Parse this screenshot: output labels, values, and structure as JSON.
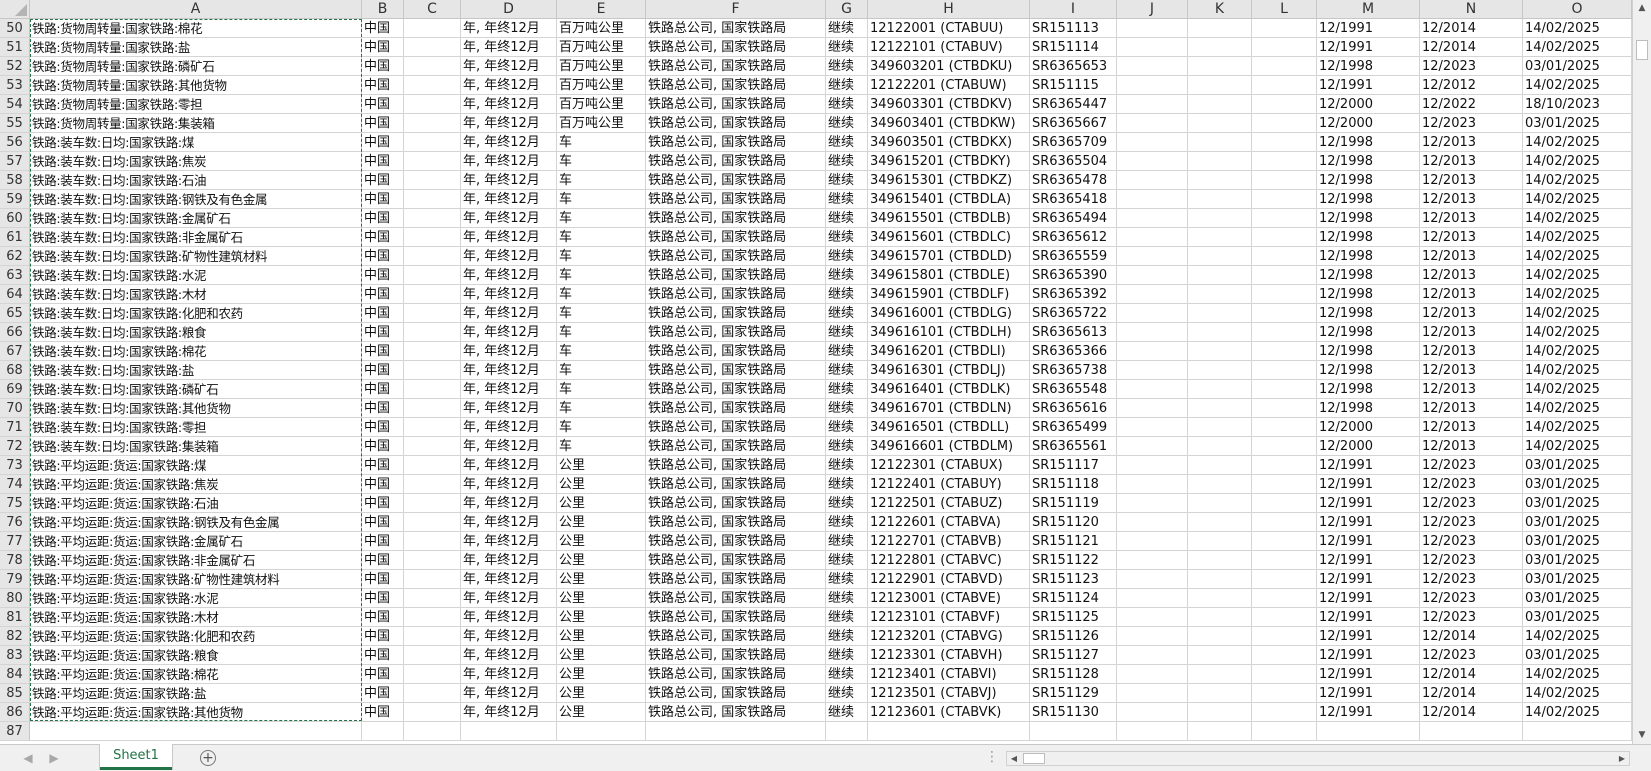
{
  "columns": [
    "A",
    "B",
    "C",
    "D",
    "E",
    "F",
    "G",
    "H",
    "I",
    "J",
    "K",
    "L",
    "M",
    "N",
    "O"
  ],
  "rows": [
    {
      "n": "50",
      "a": "铁路:货物周转量:国家铁路:棉花",
      "b": "中国",
      "d": "年, 年终12月",
      "e": "百万吨公里",
      "f": "铁路总公司, 国家铁路局",
      "g": "继续",
      "h": "12122001 (CTABUU)",
      "i": "SR151113",
      "m": "12/1991",
      "nn": "12/2014",
      "o": "14/02/2025"
    },
    {
      "n": "51",
      "a": "铁路:货物周转量:国家铁路:盐",
      "b": "中国",
      "d": "年, 年终12月",
      "e": "百万吨公里",
      "f": "铁路总公司, 国家铁路局",
      "g": "继续",
      "h": "12122101 (CTABUV)",
      "i": "SR151114",
      "m": "12/1991",
      "nn": "12/2014",
      "o": "14/02/2025"
    },
    {
      "n": "52",
      "a": "铁路:货物周转量:国家铁路:磷矿石",
      "b": "中国",
      "d": "年, 年终12月",
      "e": "百万吨公里",
      "f": "铁路总公司, 国家铁路局",
      "g": "继续",
      "h": "349603201 (CTBDKU)",
      "i": "SR6365653",
      "m": "12/1998",
      "nn": "12/2023",
      "o": "03/01/2025"
    },
    {
      "n": "53",
      "a": "铁路:货物周转量:国家铁路:其他货物",
      "b": "中国",
      "d": "年, 年终12月",
      "e": "百万吨公里",
      "f": "铁路总公司, 国家铁路局",
      "g": "继续",
      "h": "12122201 (CTABUW)",
      "i": "SR151115",
      "m": "12/1991",
      "nn": "12/2012",
      "o": "14/02/2025"
    },
    {
      "n": "54",
      "a": "铁路:货物周转量:国家铁路:零担",
      "b": "中国",
      "d": "年, 年终12月",
      "e": "百万吨公里",
      "f": "铁路总公司, 国家铁路局",
      "g": "继续",
      "h": "349603301 (CTBDKV)",
      "i": "SR6365447",
      "m": "12/2000",
      "nn": "12/2022",
      "o": "18/10/2023"
    },
    {
      "n": "55",
      "a": "铁路:货物周转量:国家铁路:集装箱",
      "b": "中国",
      "d": "年, 年终12月",
      "e": "百万吨公里",
      "f": "铁路总公司, 国家铁路局",
      "g": "继续",
      "h": "349603401 (CTBDKW)",
      "i": "SR6365667",
      "m": "12/2000",
      "nn": "12/2023",
      "o": "03/01/2025"
    },
    {
      "n": "56",
      "a": "铁路:装车数:日均:国家铁路:煤",
      "b": "中国",
      "d": "年, 年终12月",
      "e": "车",
      "f": "铁路总公司, 国家铁路局",
      "g": "继续",
      "h": "349603501 (CTBDKX)",
      "i": "SR6365709",
      "m": "12/1998",
      "nn": "12/2013",
      "o": "14/02/2025"
    },
    {
      "n": "57",
      "a": "铁路:装车数:日均:国家铁路:焦炭",
      "b": "中国",
      "d": "年, 年终12月",
      "e": "车",
      "f": "铁路总公司, 国家铁路局",
      "g": "继续",
      "h": "349615201 (CTBDKY)",
      "i": "SR6365504",
      "m": "12/1998",
      "nn": "12/2013",
      "o": "14/02/2025"
    },
    {
      "n": "58",
      "a": "铁路:装车数:日均:国家铁路:石油",
      "b": "中国",
      "d": "年, 年终12月",
      "e": "车",
      "f": "铁路总公司, 国家铁路局",
      "g": "继续",
      "h": "349615301 (CTBDKZ)",
      "i": "SR6365478",
      "m": "12/1998",
      "nn": "12/2013",
      "o": "14/02/2025"
    },
    {
      "n": "59",
      "a": "铁路:装车数:日均:国家铁路:钢铁及有色金属",
      "b": "中国",
      "d": "年, 年终12月",
      "e": "车",
      "f": "铁路总公司, 国家铁路局",
      "g": "继续",
      "h": "349615401 (CTBDLA)",
      "i": "SR6365418",
      "m": "12/1998",
      "nn": "12/2013",
      "o": "14/02/2025"
    },
    {
      "n": "60",
      "a": "铁路:装车数:日均:国家铁路:金属矿石",
      "b": "中国",
      "d": "年, 年终12月",
      "e": "车",
      "f": "铁路总公司, 国家铁路局",
      "g": "继续",
      "h": "349615501 (CTBDLB)",
      "i": "SR6365494",
      "m": "12/1998",
      "nn": "12/2013",
      "o": "14/02/2025"
    },
    {
      "n": "61",
      "a": "铁路:装车数:日均:国家铁路:非金属矿石",
      "b": "中国",
      "d": "年, 年终12月",
      "e": "车",
      "f": "铁路总公司, 国家铁路局",
      "g": "继续",
      "h": "349615601 (CTBDLC)",
      "i": "SR6365612",
      "m": "12/1998",
      "nn": "12/2013",
      "o": "14/02/2025"
    },
    {
      "n": "62",
      "a": "铁路:装车数:日均:国家铁路:矿物性建筑材料",
      "b": "中国",
      "d": "年, 年终12月",
      "e": "车",
      "f": "铁路总公司, 国家铁路局",
      "g": "继续",
      "h": "349615701 (CTBDLD)",
      "i": "SR6365559",
      "m": "12/1998",
      "nn": "12/2013",
      "o": "14/02/2025"
    },
    {
      "n": "63",
      "a": "铁路:装车数:日均:国家铁路:水泥",
      "b": "中国",
      "d": "年, 年终12月",
      "e": "车",
      "f": "铁路总公司, 国家铁路局",
      "g": "继续",
      "h": "349615801 (CTBDLE)",
      "i": "SR6365390",
      "m": "12/1998",
      "nn": "12/2013",
      "o": "14/02/2025"
    },
    {
      "n": "64",
      "a": "铁路:装车数:日均:国家铁路:木材",
      "b": "中国",
      "d": "年, 年终12月",
      "e": "车",
      "f": "铁路总公司, 国家铁路局",
      "g": "继续",
      "h": "349615901 (CTBDLF)",
      "i": "SR6365392",
      "m": "12/1998",
      "nn": "12/2013",
      "o": "14/02/2025"
    },
    {
      "n": "65",
      "a": "铁路:装车数:日均:国家铁路:化肥和农药",
      "b": "中国",
      "d": "年, 年终12月",
      "e": "车",
      "f": "铁路总公司, 国家铁路局",
      "g": "继续",
      "h": "349616001 (CTBDLG)",
      "i": "SR6365722",
      "m": "12/1998",
      "nn": "12/2013",
      "o": "14/02/2025"
    },
    {
      "n": "66",
      "a": "铁路:装车数:日均:国家铁路:粮食",
      "b": "中国",
      "d": "年, 年终12月",
      "e": "车",
      "f": "铁路总公司, 国家铁路局",
      "g": "继续",
      "h": "349616101 (CTBDLH)",
      "i": "SR6365613",
      "m": "12/1998",
      "nn": "12/2013",
      "o": "14/02/2025"
    },
    {
      "n": "67",
      "a": "铁路:装车数:日均:国家铁路:棉花",
      "b": "中国",
      "d": "年, 年终12月",
      "e": "车",
      "f": "铁路总公司, 国家铁路局",
      "g": "继续",
      "h": "349616201 (CTBDLI)",
      "i": "SR6365366",
      "m": "12/1998",
      "nn": "12/2013",
      "o": "14/02/2025"
    },
    {
      "n": "68",
      "a": "铁路:装车数:日均:国家铁路:盐",
      "b": "中国",
      "d": "年, 年终12月",
      "e": "车",
      "f": "铁路总公司, 国家铁路局",
      "g": "继续",
      "h": "349616301 (CTBDLJ)",
      "i": "SR6365738",
      "m": "12/1998",
      "nn": "12/2013",
      "o": "14/02/2025"
    },
    {
      "n": "69",
      "a": "铁路:装车数:日均:国家铁路:磷矿石",
      "b": "中国",
      "d": "年, 年终12月",
      "e": "车",
      "f": "铁路总公司, 国家铁路局",
      "g": "继续",
      "h": "349616401 (CTBDLK)",
      "i": "SR6365548",
      "m": "12/1998",
      "nn": "12/2013",
      "o": "14/02/2025"
    },
    {
      "n": "70",
      "a": "铁路:装车数:日均:国家铁路:其他货物",
      "b": "中国",
      "d": "年, 年终12月",
      "e": "车",
      "f": "铁路总公司, 国家铁路局",
      "g": "继续",
      "h": "349616701 (CTBDLN)",
      "i": "SR6365616",
      "m": "12/1998",
      "nn": "12/2013",
      "o": "14/02/2025"
    },
    {
      "n": "71",
      "a": "铁路:装车数:日均:国家铁路:零担",
      "b": "中国",
      "d": "年, 年终12月",
      "e": "车",
      "f": "铁路总公司, 国家铁路局",
      "g": "继续",
      "h": "349616501 (CTBDLL)",
      "i": "SR6365499",
      "m": "12/2000",
      "nn": "12/2013",
      "o": "14/02/2025"
    },
    {
      "n": "72",
      "a": "铁路:装车数:日均:国家铁路:集装箱",
      "b": "中国",
      "d": "年, 年终12月",
      "e": "车",
      "f": "铁路总公司, 国家铁路局",
      "g": "继续",
      "h": "349616601 (CTBDLM)",
      "i": "SR6365561",
      "m": "12/2000",
      "nn": "12/2013",
      "o": "14/02/2025"
    },
    {
      "n": "73",
      "a": "铁路:平均运距:货运:国家铁路:煤",
      "b": "中国",
      "d": "年, 年终12月",
      "e": "公里",
      "f": "铁路总公司, 国家铁路局",
      "g": "继续",
      "h": "12122301 (CTABUX)",
      "i": "SR151117",
      "m": "12/1991",
      "nn": "12/2023",
      "o": "03/01/2025"
    },
    {
      "n": "74",
      "a": "铁路:平均运距:货运:国家铁路:焦炭",
      "b": "中国",
      "d": "年, 年终12月",
      "e": "公里",
      "f": "铁路总公司, 国家铁路局",
      "g": "继续",
      "h": "12122401 (CTABUY)",
      "i": "SR151118",
      "m": "12/1991",
      "nn": "12/2023",
      "o": "03/01/2025"
    },
    {
      "n": "75",
      "a": "铁路:平均运距:货运:国家铁路:石油",
      "b": "中国",
      "d": "年, 年终12月",
      "e": "公里",
      "f": "铁路总公司, 国家铁路局",
      "g": "继续",
      "h": "12122501 (CTABUZ)",
      "i": "SR151119",
      "m": "12/1991",
      "nn": "12/2023",
      "o": "03/01/2025"
    },
    {
      "n": "76",
      "a": "铁路:平均运距:货运:国家铁路:钢铁及有色金属",
      "b": "中国",
      "d": "年, 年终12月",
      "e": "公里",
      "f": "铁路总公司, 国家铁路局",
      "g": "继续",
      "h": "12122601 (CTABVA)",
      "i": "SR151120",
      "m": "12/1991",
      "nn": "12/2023",
      "o": "03/01/2025"
    },
    {
      "n": "77",
      "a": "铁路:平均运距:货运:国家铁路:金属矿石",
      "b": "中国",
      "d": "年, 年终12月",
      "e": "公里",
      "f": "铁路总公司, 国家铁路局",
      "g": "继续",
      "h": "12122701 (CTABVB)",
      "i": "SR151121",
      "m": "12/1991",
      "nn": "12/2023",
      "o": "03/01/2025"
    },
    {
      "n": "78",
      "a": "铁路:平均运距:货运:国家铁路:非金属矿石",
      "b": "中国",
      "d": "年, 年终12月",
      "e": "公里",
      "f": "铁路总公司, 国家铁路局",
      "g": "继续",
      "h": "12122801 (CTABVC)",
      "i": "SR151122",
      "m": "12/1991",
      "nn": "12/2023",
      "o": "03/01/2025"
    },
    {
      "n": "79",
      "a": "铁路:平均运距:货运:国家铁路:矿物性建筑材料",
      "b": "中国",
      "d": "年, 年终12月",
      "e": "公里",
      "f": "铁路总公司, 国家铁路局",
      "g": "继续",
      "h": "12122901 (CTABVD)",
      "i": "SR151123",
      "m": "12/1991",
      "nn": "12/2023",
      "o": "03/01/2025"
    },
    {
      "n": "80",
      "a": "铁路:平均运距:货运:国家铁路:水泥",
      "b": "中国",
      "d": "年, 年终12月",
      "e": "公里",
      "f": "铁路总公司, 国家铁路局",
      "g": "继续",
      "h": "12123001 (CTABVE)",
      "i": "SR151124",
      "m": "12/1991",
      "nn": "12/2023",
      "o": "03/01/2025"
    },
    {
      "n": "81",
      "a": "铁路:平均运距:货运:国家铁路:木材",
      "b": "中国",
      "d": "年, 年终12月",
      "e": "公里",
      "f": "铁路总公司, 国家铁路局",
      "g": "继续",
      "h": "12123101 (CTABVF)",
      "i": "SR151125",
      "m": "12/1991",
      "nn": "12/2023",
      "o": "03/01/2025"
    },
    {
      "n": "82",
      "a": "铁路:平均运距:货运:国家铁路:化肥和农药",
      "b": "中国",
      "d": "年, 年终12月",
      "e": "公里",
      "f": "铁路总公司, 国家铁路局",
      "g": "继续",
      "h": "12123201 (CTABVG)",
      "i": "SR151126",
      "m": "12/1991",
      "nn": "12/2014",
      "o": "14/02/2025"
    },
    {
      "n": "83",
      "a": "铁路:平均运距:货运:国家铁路:粮食",
      "b": "中国",
      "d": "年, 年终12月",
      "e": "公里",
      "f": "铁路总公司, 国家铁路局",
      "g": "继续",
      "h": "12123301 (CTABVH)",
      "i": "SR151127",
      "m": "12/1991",
      "nn": "12/2023",
      "o": "03/01/2025"
    },
    {
      "n": "84",
      "a": "铁路:平均运距:货运:国家铁路:棉花",
      "b": "中国",
      "d": "年, 年终12月",
      "e": "公里",
      "f": "铁路总公司, 国家铁路局",
      "g": "继续",
      "h": "12123401 (CTABVI)",
      "i": "SR151128",
      "m": "12/1991",
      "nn": "12/2014",
      "o": "14/02/2025"
    },
    {
      "n": "85",
      "a": "铁路:平均运距:货运:国家铁路:盐",
      "b": "中国",
      "d": "年, 年终12月",
      "e": "公里",
      "f": "铁路总公司, 国家铁路局",
      "g": "继续",
      "h": "12123501 (CTABVJ)",
      "i": "SR151129",
      "m": "12/1991",
      "nn": "12/2014",
      "o": "14/02/2025"
    },
    {
      "n": "86",
      "a": "铁路:平均运距:货运:国家铁路:其他货物",
      "b": "中国",
      "d": "年, 年终12月",
      "e": "公里",
      "f": "铁路总公司, 国家铁路局",
      "g": "继续",
      "h": "12123601 (CTABVK)",
      "i": "SR151130",
      "m": "12/1991",
      "nn": "12/2014",
      "o": "14/02/2025"
    },
    {
      "n": "87",
      "a": "",
      "b": "",
      "d": "",
      "e": "",
      "f": "",
      "g": "",
      "h": "",
      "i": "",
      "m": "",
      "nn": "",
      "o": ""
    }
  ],
  "sheet_tab": "Sheet1",
  "icons": {
    "add_sheet": "plus-circle-icon",
    "scroll_up": "triangle-up",
    "scroll_down": "triangle-down",
    "scroll_left": "triangle-left",
    "scroll_right": "triangle-right",
    "prev_sheet": "chevron-left",
    "next_sheet": "chevron-right",
    "menu_dots": "vertical-ellipsis"
  },
  "colors": {
    "accent": "#217346",
    "header_bg": "#e6e6e6",
    "gridline": "#d4d4d4"
  }
}
